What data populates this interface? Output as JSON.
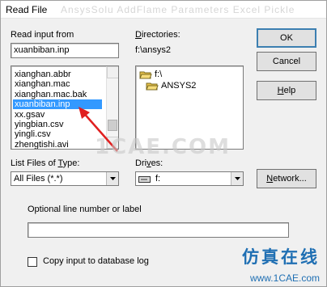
{
  "window": {
    "title": "Read File",
    "ghost_title": "AnsysSolu  AddFlame  Parameters  Excel  Pickle"
  },
  "read_input": {
    "label": "Read input from",
    "value": "xuanbiban.inp",
    "files": [
      "xianghan.abbr",
      "xianghan.mac",
      "xianghan.mac.bak",
      "xuanbiban.inp",
      "xx.gsav",
      "yingbian.csv",
      "yingli.csv",
      "zhengtishi.avi"
    ],
    "selected_index": 3
  },
  "directories": {
    "label": "Directories:",
    "path": "f:\\ansys2",
    "items": [
      "f:\\",
      "ANSYS2"
    ]
  },
  "buttons": {
    "ok": "OK",
    "cancel": "Cancel",
    "help": "Help",
    "network": "Network..."
  },
  "file_type": {
    "label": "List Files of Type:",
    "value": "All Files (*.*)"
  },
  "drives": {
    "label": "Drives:",
    "value": "f:"
  },
  "optional": {
    "label": "Optional line number or label",
    "value": ""
  },
  "copy_input": {
    "label": "Copy input to database log",
    "checked": false
  },
  "branding": {
    "watermark": "1CAE.COM",
    "logo_cn": "仿真在线",
    "logo_url": "www.1CAE.com"
  },
  "colors": {
    "selection": "#3399ff",
    "arrow": "#e02020",
    "folder": "#e8c24a"
  }
}
